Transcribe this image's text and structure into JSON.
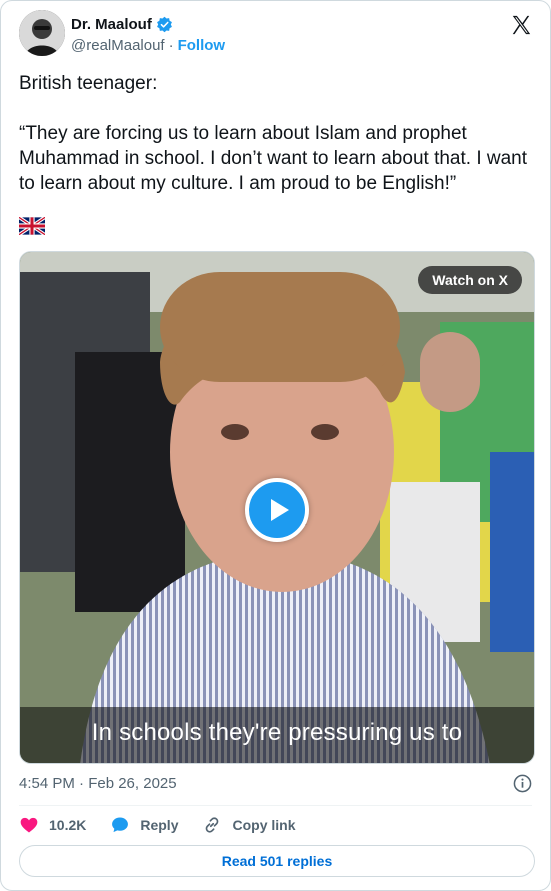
{
  "author": {
    "name": "Dr. Maalouf",
    "handle": "@realMaalouf",
    "separator": "·",
    "follow_label": "Follow",
    "verified_color": "#1d9bf0"
  },
  "tweet": {
    "paragraphs": [
      "British teenager:",
      "“They are forcing us to learn about Islam and prophet Muhammad in school. I don’t want to learn about that. I want to learn about my culture. I am proud to be English!”"
    ],
    "flag_icon": "uk-flag-icon"
  },
  "media": {
    "watch_label": "Watch on X",
    "caption": "In schools they're pressuring us to",
    "play_icon": "play-icon"
  },
  "meta": {
    "timestamp": "4:54 PM · Feb 26, 2025"
  },
  "actions": {
    "likes": "10.2K",
    "reply_label": "Reply",
    "copy_link_label": "Copy link"
  },
  "read_replies_label": "Read 501 replies",
  "colors": {
    "accent": "#1d9bf0",
    "like": "#f91880",
    "muted": "#536471",
    "link": "#006fd6"
  }
}
